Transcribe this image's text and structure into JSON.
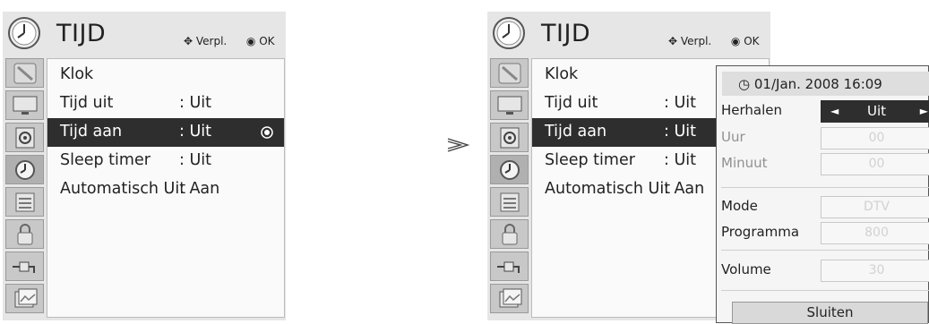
{
  "panel_left": {
    "title": "TIJD",
    "hint_move": "Verpl.",
    "hint_ok": "OK",
    "items": [
      {
        "label": "Klok",
        "value": ""
      },
      {
        "label": "Tijd uit",
        "value": ": Uit"
      },
      {
        "label": "Tijd aan",
        "value": ": Uit"
      },
      {
        "label": "Sleep timer",
        "value": ": Uit"
      },
      {
        "label": "Automatisch Uit",
        "value": ": Aan"
      }
    ],
    "selected_item": "Tijd aan"
  },
  "panel_right": {
    "title": "TIJD",
    "hint_move": "Verpl.",
    "hint_ok": "OK",
    "items": [
      {
        "label": "Klok",
        "value": ""
      },
      {
        "label": "Tijd uit",
        "value": ": Uit"
      },
      {
        "label": "Tijd aan",
        "value": ": Uit"
      },
      {
        "label": "Sleep timer",
        "value": ": Uit"
      },
      {
        "label": "Automatisch Uit",
        "value": ": Aan"
      }
    ],
    "selected_item": "Tijd aan"
  },
  "transition_arrow_icon": "double-chevron-right-icon",
  "popup": {
    "datetime": "01/Jan. 2008 16:09",
    "rows": [
      {
        "label": "Herhalen",
        "value": "Uit"
      },
      {
        "label": "Uur",
        "value": "00"
      },
      {
        "label": "Minuut",
        "value": "00"
      },
      {
        "label": "Mode",
        "value": "DTV"
      },
      {
        "label": "Programma",
        "value": "800"
      },
      {
        "label": "Volume",
        "value": "30"
      }
    ],
    "close_label": "Sluiten"
  },
  "icons": [
    "picture-icon",
    "monitor-icon",
    "speaker-icon",
    "clock-icon",
    "options-icon",
    "lock-icon",
    "input-plug-icon",
    "photo-icon"
  ],
  "colors": {
    "panel_bg": "#e6e6e6",
    "selected_row": "#2e2e2e",
    "menu_bg": "#fafafa"
  }
}
